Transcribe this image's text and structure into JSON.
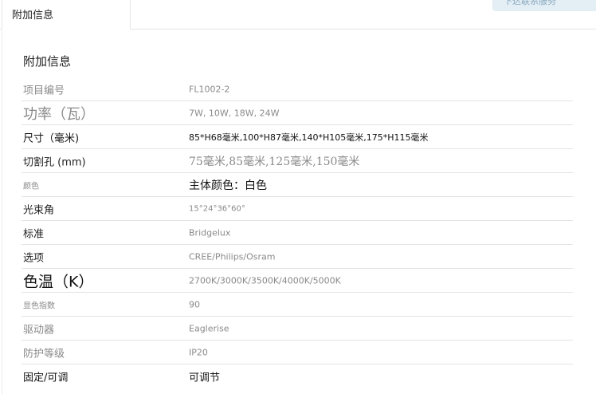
{
  "tab": {
    "label": "附加信息"
  },
  "notice": {
    "text": "下达联系服务"
  },
  "section": {
    "title": "附加信息"
  },
  "attributes": [
    {
      "label": "项目编号",
      "value": "FL1002-2"
    },
    {
      "label": "功率（瓦）",
      "value": "7W, 10W, 18W, 24W"
    },
    {
      "label": "尺寸（毫米)",
      "value": "85*H68毫米,100*H87毫米,140*H105毫米,175*H115毫米"
    },
    {
      "label": "切割孔 (mm)",
      "value": "75毫米,85毫米,125毫米,150毫米"
    },
    {
      "label": "颜色",
      "value": "主体颜色：白色"
    },
    {
      "label": "光束角",
      "value": "15°24°36°60°"
    },
    {
      "label": "标准",
      "value": "Bridgelux"
    },
    {
      "label": "选项",
      "value": "CREE/Philips/Osram"
    },
    {
      "label": "色温（K）",
      "value": "2700K/3000K/3500K/4000K/5000K"
    },
    {
      "label": "显色指数",
      "value": "90"
    },
    {
      "label": "驱动器",
      "value": "Eaglerise"
    },
    {
      "label": "防护等级",
      "value": "IP20"
    },
    {
      "label": "固定/可调",
      "value": "可调节"
    }
  ]
}
